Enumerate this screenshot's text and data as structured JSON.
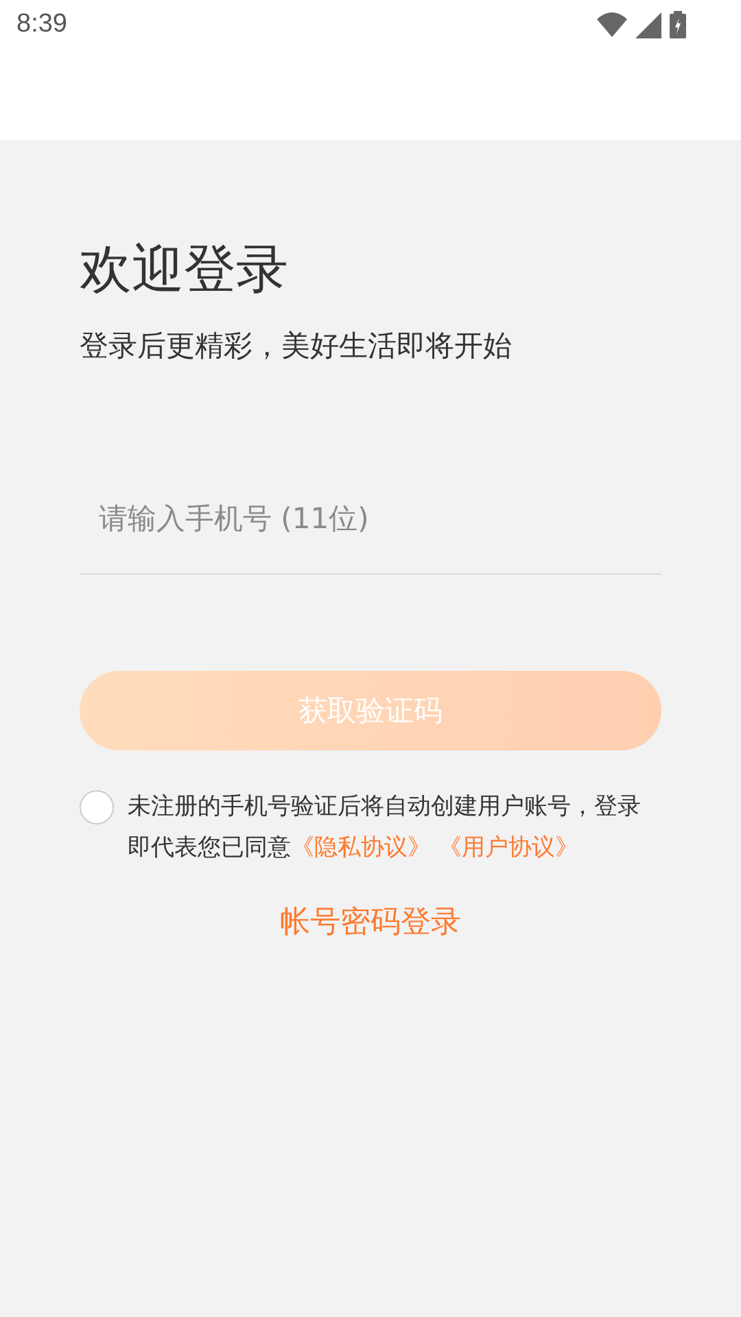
{
  "status_bar": {
    "time": "8:39"
  },
  "title": "欢迎登录",
  "subtitle": "登录后更精彩，美好生活即将开始",
  "phone_field": {
    "placeholder": "请输入手机号 (11位)"
  },
  "get_code_button": {
    "label": "获取验证码",
    "disabled": true
  },
  "agreement": {
    "checked": false,
    "text": "未注册的手机号验证后将自动创建用户账号，登录即代表您已同意",
    "links": [
      "《隐私协议》",
      "《用户协议》"
    ]
  },
  "password_login_link": "帐号密码登录"
}
